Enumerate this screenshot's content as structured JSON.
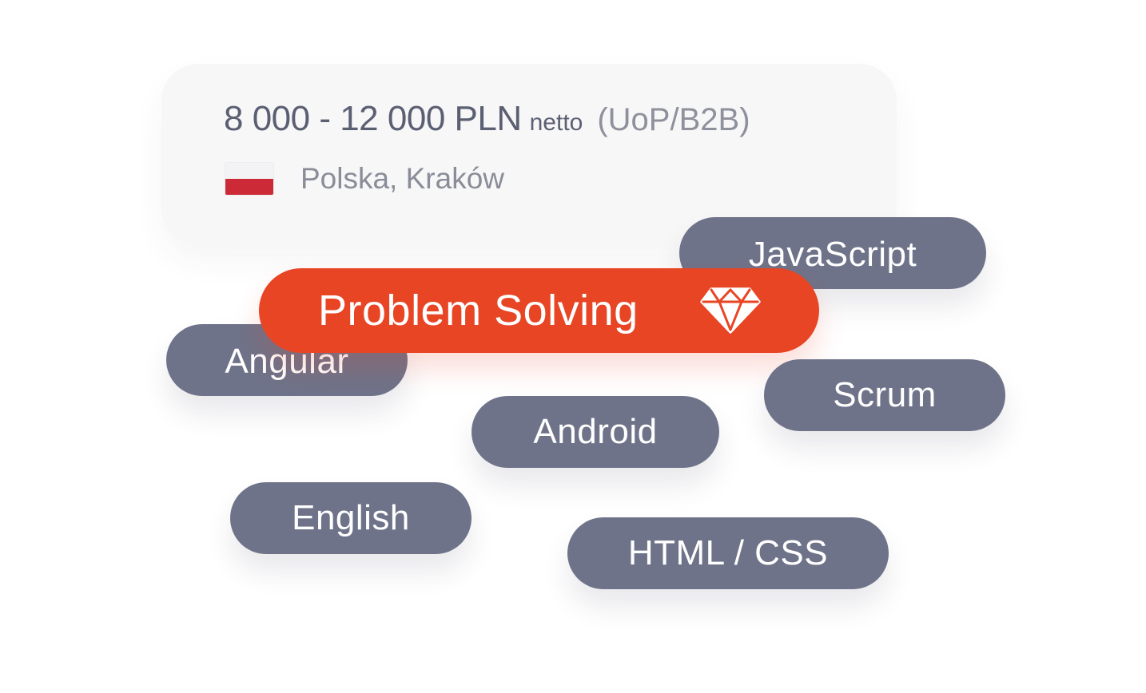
{
  "offer": {
    "salary": "8 000 - 12 000 PLN",
    "netto": "netto",
    "contract": "(UoP/B2B)",
    "location": "Polska, Kraków",
    "flag_icon": "poland-flag-icon",
    "flag_colors": {
      "top": "#f3f3f5",
      "bottom": "#cc2a37"
    }
  },
  "featured_skill": {
    "label": "Problem Solving",
    "icon": "diamond-icon",
    "color": "#e84525"
  },
  "skills": {
    "javascript": "JavaScript",
    "angular": "Angular",
    "scrum": "Scrum",
    "android": "Android",
    "english": "English",
    "html_css": "HTML / CSS",
    "tag_color": "#6f7389"
  }
}
